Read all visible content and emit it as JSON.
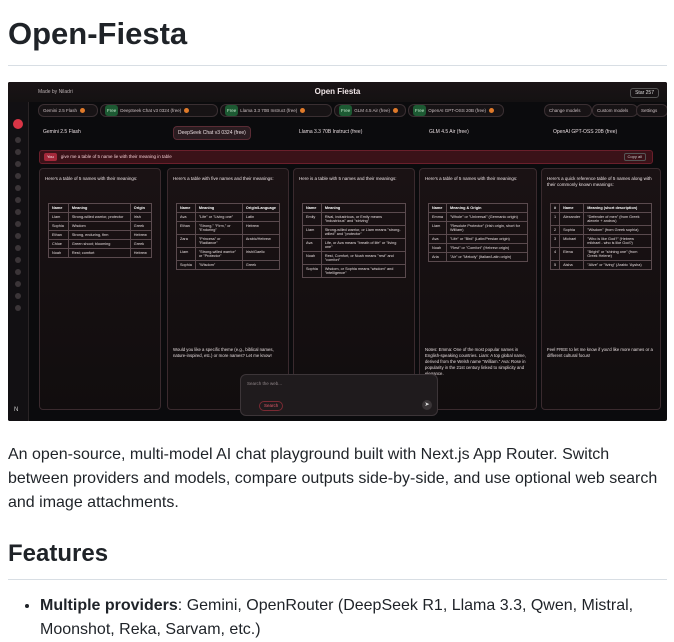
{
  "title": "Open-Fiesta",
  "screenshot": {
    "app_title": "Open Fiesta",
    "made_by": "Made by Niladri",
    "star_label": "Star 257",
    "model_chips": [
      "Gemini 2.5 Flash",
      "DeepSeek Chat v3 0324 (free)",
      "Llama 3.3 70B Instruct (free)",
      "GLM 4.5 Air (free)",
      "OpenAI GPT-OSS 20B (free)"
    ],
    "toolbar": [
      "Change models",
      "Custom models",
      "Settings"
    ],
    "prompt_tag": "You",
    "prompt_text": "give me a table of 5 name lie with their meaning in table",
    "copy_label": "Copy all",
    "columns": [
      {
        "head": "Gemini 2.5 Flash",
        "intro": "Here's a table of 5 names with their meanings:",
        "headers": [
          "Name",
          "Meaning",
          "Origin"
        ],
        "rows": [
          [
            "Liam",
            "Strong-willed warrior, protector",
            "Irish"
          ],
          [
            "Sophia",
            "Wisdom",
            "Greek"
          ],
          [
            "Ethan",
            "Strong, enduring, firm",
            "Hebrew"
          ],
          [
            "Chloe",
            "Green shoot; blooming",
            "Greek"
          ],
          [
            "Noah",
            "Rest; comfort",
            "Hebrew"
          ]
        ],
        "foot": ""
      },
      {
        "head": "DeepSeek Chat v3 0324 (free)",
        "intro": "Here's a table with five names and their meanings:",
        "headers": [
          "Name",
          "Meaning",
          "Origin/Language"
        ],
        "rows": [
          [
            "Ava",
            "\"Life\" or \"Living one\"",
            "Latin"
          ],
          [
            "Ethan",
            "\"Strong,\" \"Firm,\" or \"Enduring\"",
            "Hebrew"
          ],
          [
            "Zara",
            "\"Princess\" or \"Radiance\"",
            "Arabic/Hebrew"
          ],
          [
            "Liam",
            "\"Strong-willed warrior\" or \"Protector\"",
            "Irish/Gaelic"
          ],
          [
            "Sophia",
            "\"Wisdom\"",
            "Greek"
          ]
        ],
        "foot": "Would you like a specific theme (e.g., biblical names, nature-inspired, etc.) or more names? Let me know!"
      },
      {
        "head": "Llama 3.3 70B Instruct (free)",
        "intro": "Here is a table with 5 names and their meanings:",
        "headers": [
          "Name",
          "Meaning"
        ],
        "rows": [
          [
            "Emily",
            "Rival, industrious, or Emily means \"industrious\" and \"striving\""
          ],
          [
            "Liam",
            "Strong-willed warrior, or Liam means \"strong-willed\" and \"protector\""
          ],
          [
            "Ava",
            "Life, or Ava means \"breath of life\" or \"living one\""
          ],
          [
            "Noah",
            "Rest, Comfort, or Noah means \"rest\" and \"comfort\""
          ],
          [
            "Sophia",
            "Wisdom, or Sophia means \"wisdom\" and \"intelligence\""
          ]
        ],
        "foot": ""
      },
      {
        "head": "GLM 4.5 Air (free)",
        "intro": "Here's a table of 5 names with their meanings:",
        "headers": [
          "Name",
          "Meaning & Origin"
        ],
        "rows": [
          [
            "Emma",
            "\"Whole\" or \"Universal\" (Germanic origin)"
          ],
          [
            "Liam",
            "\"Resolute Protector\" (Irish origin, short for William)"
          ],
          [
            "Ava",
            "\"Life\" or \"Bird\" (Latin/Persian origin)"
          ],
          [
            "Noah",
            "\"Rest\" or \"Comfort\" (Hebrew origin)"
          ],
          [
            "Aria",
            "\"Air\" or \"Melody\" (Italian/Latin origin)"
          ]
        ],
        "foot": "Notes: Emma: One of the most popular names in English-speaking countries. Liam: A top global name, derived from the Welsh name \"William.\" Ava: Rose in popularity in the 21st century linked to simplicity and elegance."
      },
      {
        "head": "OpenAI GPT-OSS 20B (free)",
        "intro": "Here's a quick reference table of 5 names along with their commonly known meanings:",
        "headers": [
          "#",
          "Name",
          "Meaning (short description)"
        ],
        "rows": [
          [
            "1",
            "Alexander",
            "\"Defender of men\" (from Greek alexein + andros)"
          ],
          [
            "2",
            "Sophia",
            "\"Wisdom\" (from Greek sophia)"
          ],
          [
            "3",
            "Michael",
            "\"Who is like God?\" (Hebrew mikhael - who is like God?)"
          ],
          [
            "4",
            "Elena",
            "\"Bright\" or \"shining one\" (from Greek Helene)"
          ],
          [
            "5",
            "Aisha",
            "\"Alive\" or \"living\" (Arabic 'Aysha)"
          ]
        ],
        "foot": "Feel FREE to let me know if you'd like more names or a different cultural focus!"
      }
    ],
    "input_placeholder": "Search the web...",
    "search_label": "Search"
  },
  "intro": "An open-source, multi-model AI chat playground built with Next.js App Router. Switch between providers and models, compare outputs side-by-side, and use optional web search and image attachments.",
  "features_heading": "Features",
  "features": [
    {
      "bold": "Multiple providers",
      "text": ": Gemini, OpenRouter (DeepSeek R1, Llama 3.3, Qwen, Mistral, Moonshot, Reka, Sarvam, etc.)"
    }
  ]
}
